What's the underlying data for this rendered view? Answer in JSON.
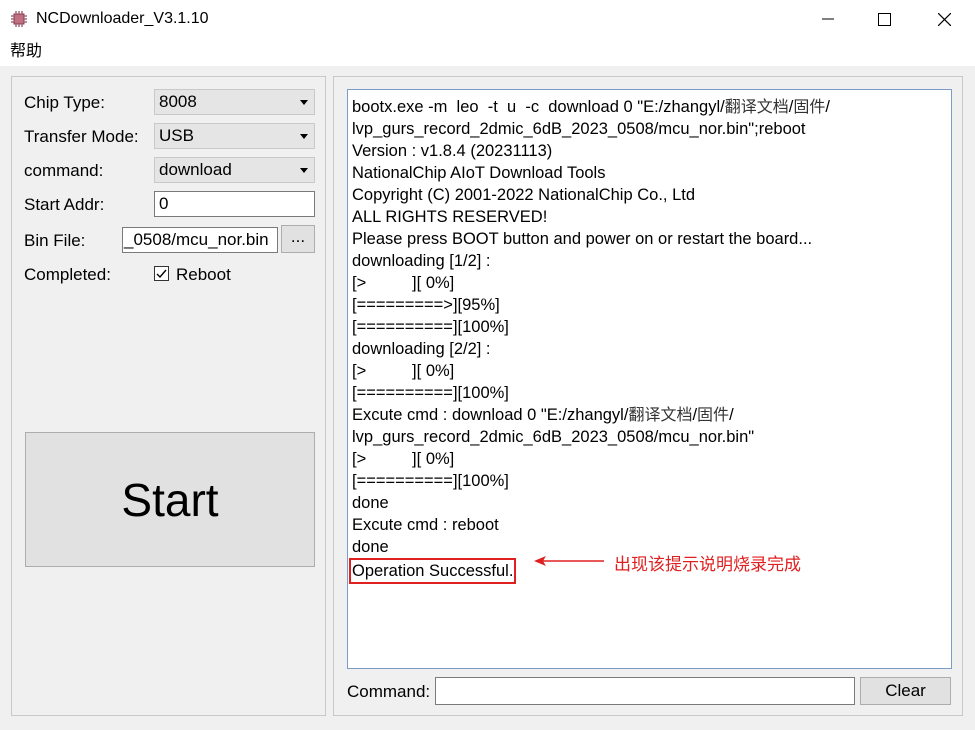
{
  "window": {
    "title": "NCDownloader_V3.1.10",
    "app_icon": "chip-icon"
  },
  "menu": {
    "items": [
      {
        "label": "帮助"
      }
    ]
  },
  "settings": {
    "chip_type_label": "Chip Type:",
    "chip_type_value": "8008",
    "transfer_mode_label": "Transfer Mode:",
    "transfer_mode_value": "USB",
    "command_label": "command:",
    "command_value": "download",
    "start_addr_label": "Start Addr:",
    "start_addr_value": "0",
    "bin_file_label": "Bin File:",
    "bin_file_value": "_0508/mcu_nor.bin",
    "browse_label": "...",
    "completed_label": "Completed:",
    "reboot_label": "Reboot",
    "reboot_checked": true
  },
  "start_button": {
    "label": "Start"
  },
  "console": {
    "lines": [
      [
        "bootx.exe -m  leo  -t  u  -c  download 0 \"E:/zhangyl/",
        "翻译文档",
        "/",
        "固件",
        "/"
      ],
      [
        "lvp_gurs_record_2dmic_6dB_2023_0508/mcu_nor.bin\";reboot"
      ],
      [
        "Version : v1.8.4 (20231113)"
      ],
      [
        "NationalChip AIoT Download Tools"
      ],
      [
        "Copyright (C) 2001-2022 NationalChip Co., Ltd"
      ],
      [
        "ALL RIGHTS RESERVED!"
      ],
      [
        "Please press BOOT button and power on or restart the board..."
      ],
      [
        "downloading [1/2] :"
      ],
      [
        "[>          ][ 0%]"
      ],
      [
        "[=========>][95%]"
      ],
      [
        "[==========][100%]"
      ],
      [
        "downloading [2/2] :"
      ],
      [
        "[>          ][ 0%]"
      ],
      [
        "[==========][100%]"
      ],
      [
        "Excute cmd : download 0 \"E:/zhangyl/",
        "翻译文档",
        "/",
        "固件",
        "/"
      ],
      [
        "lvp_gurs_record_2dmic_6dB_2023_0508/mcu_nor.bin\""
      ],
      [
        "[>          ][ 0%]"
      ],
      [
        "[==========][100%]"
      ],
      [
        "done"
      ],
      [
        "Excute cmd : reboot"
      ],
      [
        "done"
      ]
    ],
    "success_line": "Operation Successful.",
    "annotation": "出现该提示说明烧录完成",
    "annotation_color": "#e02020"
  },
  "command_bar": {
    "label": "Command:",
    "value": "",
    "clear_label": "Clear"
  }
}
